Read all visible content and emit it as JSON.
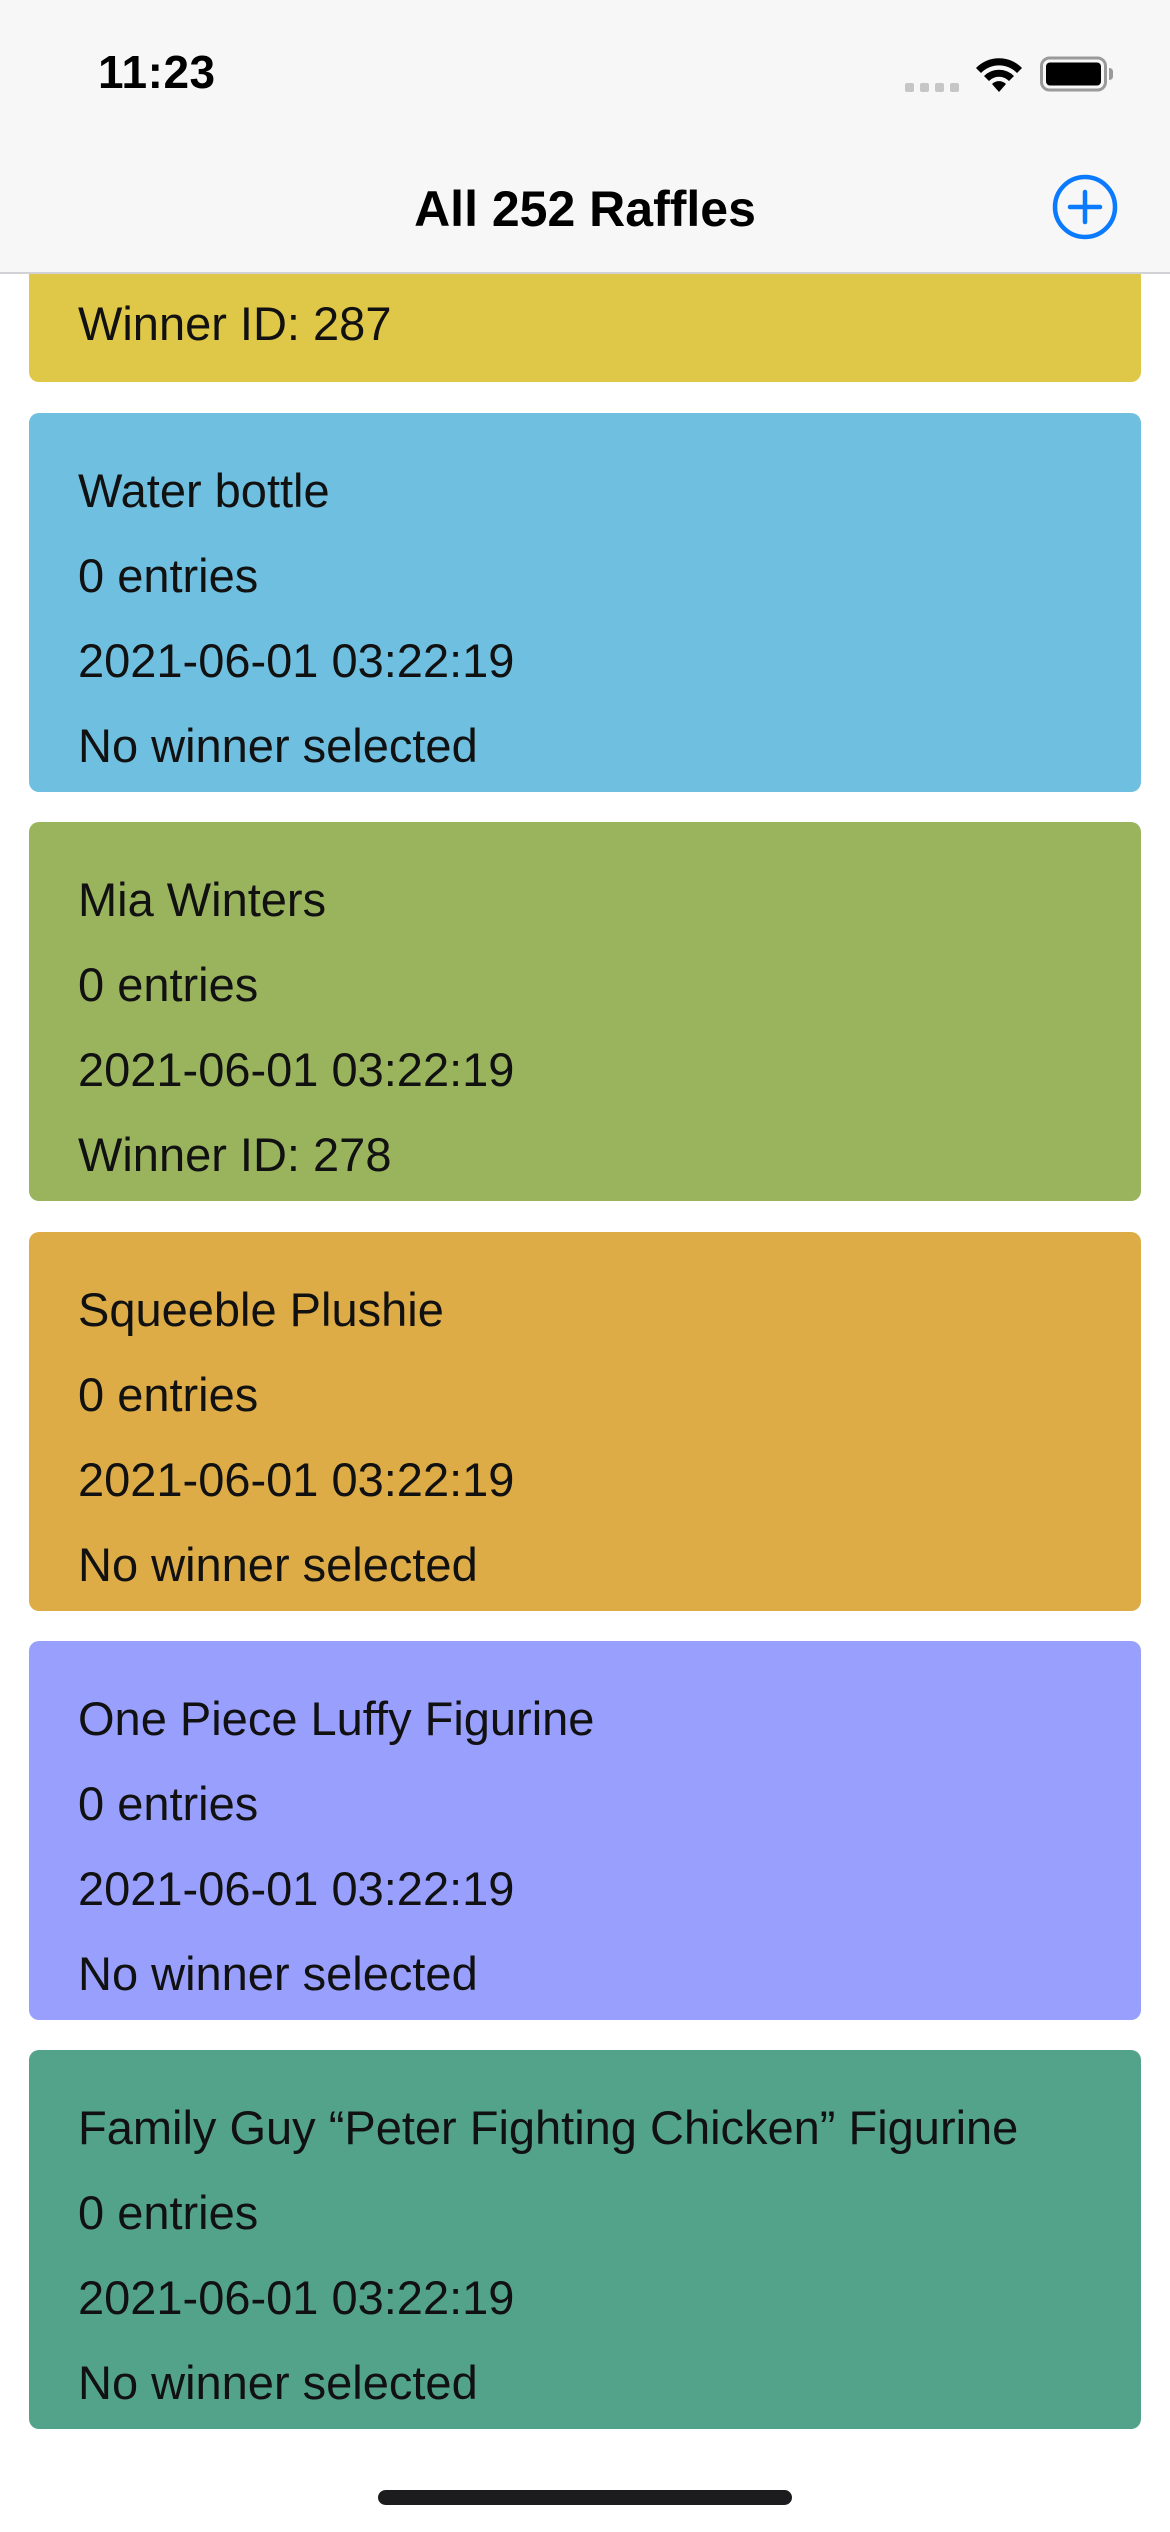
{
  "status_bar": {
    "time": "11:23"
  },
  "nav": {
    "title": "All 252 Raffles",
    "add_icon": "plus-circle-icon",
    "accent": "#0a7aff"
  },
  "raffles": [
    {
      "name": "",
      "entries": "",
      "date": "",
      "winner": "Winner ID: 287",
      "color": "#dfc747"
    },
    {
      "name": "Water bottle",
      "entries": "0 entries",
      "date": "2021-06-01 03:22:19",
      "winner": "No winner selected",
      "color": "#6ebfe0"
    },
    {
      "name": "Mia Winters",
      "entries": "0 entries",
      "date": "2021-06-01 03:22:19",
      "winner": "Winner ID: 278",
      "color": "#9ab45e"
    },
    {
      "name": "Squeeble Plushie",
      "entries": "0 entries",
      "date": "2021-06-01 03:22:19",
      "winner": "No winner selected",
      "color": "#ddac47"
    },
    {
      "name": "One Piece Luffy Figurine",
      "entries": "0 entries",
      "date": "2021-06-01 03:22:19",
      "winner": "No winner selected",
      "color": "#989ffd"
    },
    {
      "name": "Family Guy “Peter Fighting Chicken” Figurine",
      "entries": "0 entries",
      "date": "2021-06-01 03:22:19",
      "winner": "No winner selected",
      "color": "#53a38b"
    }
  ]
}
